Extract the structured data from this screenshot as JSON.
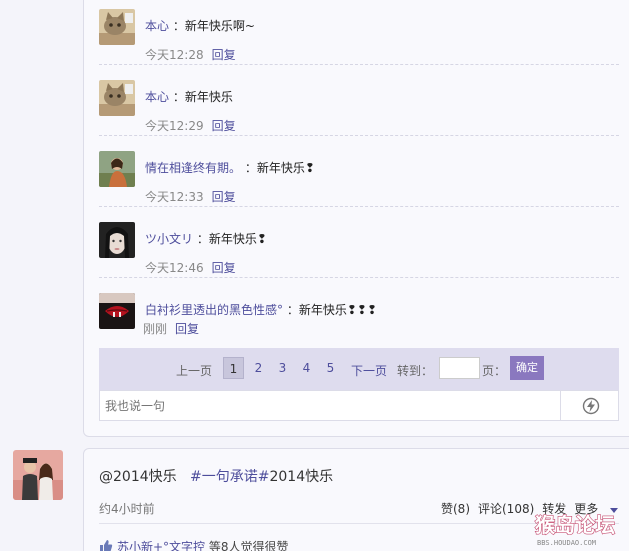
{
  "comments": [
    {
      "user": "本心",
      "text": "新年快乐啊~",
      "time": "今天12:28"
    },
    {
      "user": "本心",
      "text": "新年快乐",
      "time": "今天12:29"
    },
    {
      "user": "情在相逢终有期。",
      "text": "新年快乐❢",
      "time": "今天12:33"
    },
    {
      "user": "ツ小文リ",
      "text": "新年快乐❢",
      "time": "今天12:46"
    },
    {
      "user": "白衬衫里透出的黑色性感°",
      "text": "新年快乐❢❢❢",
      "time": "刚刚"
    }
  ],
  "comment_colon": "：",
  "reply_label": "回复",
  "pager": {
    "prev": "上一页",
    "pages": [
      "1",
      "2",
      "3",
      "4",
      "5"
    ],
    "current": "1",
    "next": "下一页",
    "goto": "转到：",
    "page_suffix": "页：",
    "ok": "确定"
  },
  "say_placeholder": "我也说一句",
  "post": {
    "mention": "@2014快乐",
    "tag": "#一句承诺#",
    "tag_rest": "2014快乐",
    "time": "约4小时前",
    "like": "赞(8)",
    "comment": "评论(108)",
    "forward": "转发",
    "more": "更多",
    "like_names": "苏小新+°文字控",
    "like_rest": "等8人觉得很赞"
  },
  "watermark": {
    "title": "猴岛论坛",
    "url": "BBS.HOUDAO.COM"
  },
  "colors": {
    "link": "#4e4e9c",
    "pager_bg": "#dedcee",
    "ok_button": "#8a78bf"
  },
  "icons": [
    "cat-avatar",
    "cat-avatar",
    "girl-avatar",
    "girl-face-avatar",
    "red-lips-avatar",
    "lightning-icon",
    "couple-avatar",
    "thumbs-up-icon",
    "dropdown-arrow-icon"
  ]
}
